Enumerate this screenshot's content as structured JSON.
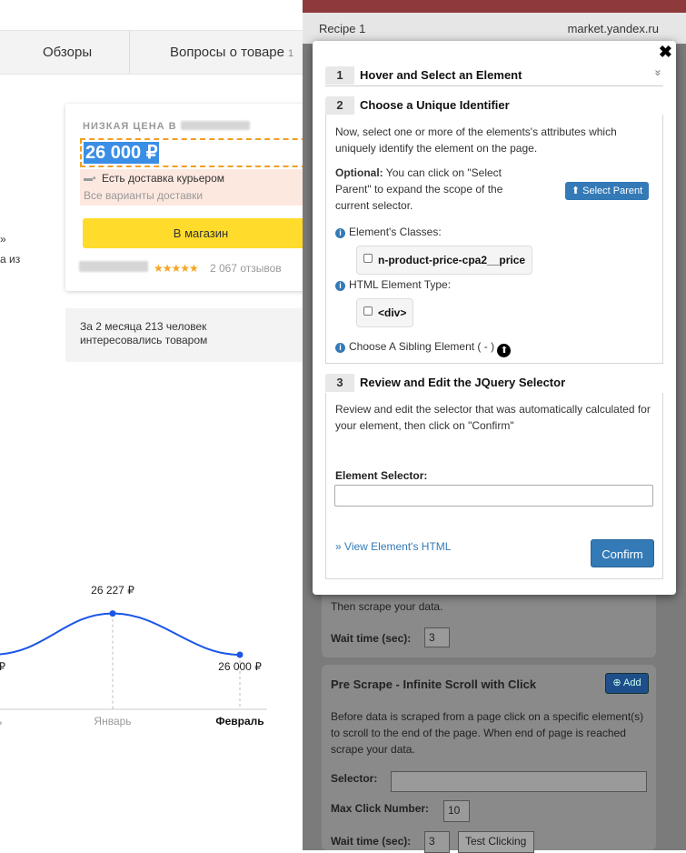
{
  "tabs": [
    {
      "label": "Обзоры",
      "count": ""
    },
    {
      "label": "Вопросы о товаре",
      "count": "1"
    }
  ],
  "offer": {
    "low_price_label": "НИЗКАЯ ЦЕНА В",
    "price": "26 000 ₽",
    "delivery": "Есть доставка курьером",
    "delivery_all": "Все варианты доставки",
    "shop_button": "В магазин",
    "stars": "★★★★★",
    "reviews": "2 067 отзывов"
  },
  "interest": {
    "text": "За 2 месяца 213 человек интересовались товаром"
  },
  "edge_texts": [
    "»",
    "а из"
  ],
  "chart_data": {
    "type": "line",
    "categories": [
      "ь",
      "Январь",
      "Февраль"
    ],
    "series": [
      {
        "values": [
          null,
          26227,
          26000
        ]
      }
    ],
    "data_labels": [
      "₽",
      "26 227 ₽",
      "26 000 ₽"
    ],
    "line_color": "#1a56e8",
    "grid": false
  },
  "recipe": {
    "name": "Recipe 1",
    "host": "market.yandex.ru"
  },
  "modal": {
    "close": "✖",
    "collapse_icon": "»",
    "step1": {
      "num": "1",
      "title": "Hover and Select an Element"
    },
    "step2": {
      "num": "2",
      "title": "Choose a Unique Identifier",
      "intro": "Now, select one or more of the elements's attributes which uniquely identify the element on the page.",
      "optional_bold": "Optional:",
      "optional_text": " You can click on \"Select Parent\" to expand the scope of the current selector.",
      "select_parent": "Select Parent",
      "classes_label": "Element's Classes:",
      "class_chip": "n-product-price-cpa2__price",
      "type_label": "HTML Element Type:",
      "type_chip": "<div>",
      "sibling_label": "Choose A Sibling Element ( - )"
    },
    "step3": {
      "num": "3",
      "title": "Review and Edit the JQuery Selector",
      "intro": "Review and edit the selector that was automatically calculated for your element, then click on \"Confirm\"",
      "selector_label": "Element Selector:",
      "selector_value": "",
      "view_html": "View Element's HTML",
      "confirm": "Confirm"
    }
  },
  "background_panel": {
    "card1": {
      "text": "Then scrape your data.",
      "wait_label": "Wait time (sec):",
      "wait_value": "3"
    },
    "card2": {
      "title": "Pre Scrape - Infinite Scroll with Click",
      "add": "Add",
      "desc": "Before data is scraped from a page click on a specific element(s) to scroll to the end of the page. When end of page is reached scrape your data.",
      "selector_label": "Selector:",
      "selector_value": "",
      "max_label": "Max Click Number:",
      "max_value": "10",
      "wait_label": "Wait time (sec):",
      "wait_value": "3",
      "test_button": "Test Clicking"
    }
  },
  "colors": {
    "accent": "#337ab7",
    "yellow": "#ffdb2b",
    "highlight": "#3a8ee6",
    "overlay": "#7b7b7b"
  }
}
